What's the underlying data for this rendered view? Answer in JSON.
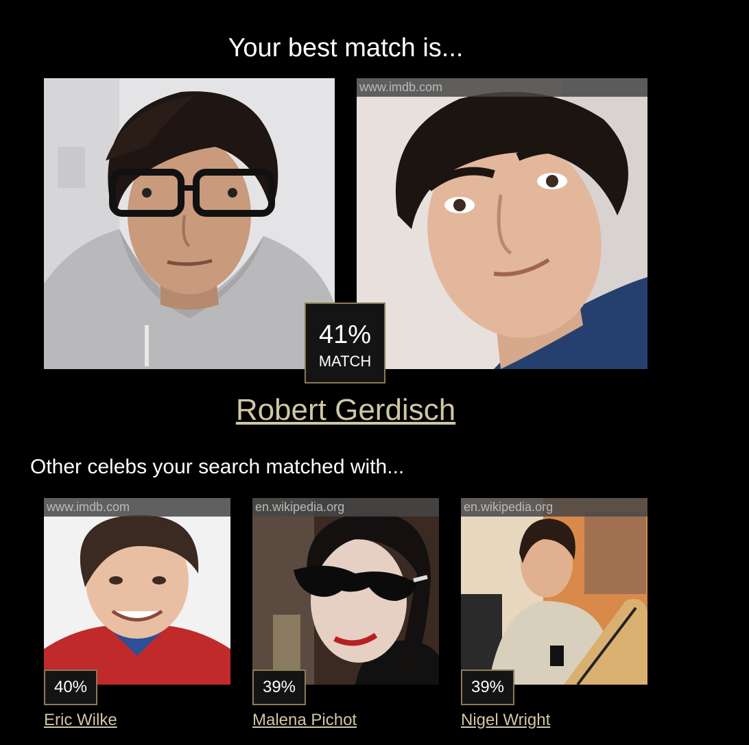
{
  "heading": "Your best match is...",
  "user_photo": {
    "alt": "your photo"
  },
  "best_match": {
    "source": "www.imdb.com",
    "percent": "41%",
    "match_label": "MATCH",
    "name": "Robert Gerdisch"
  },
  "others_heading": "Other celebs your search matched with...",
  "others": [
    {
      "source": "www.imdb.com",
      "percent": "40%",
      "name": "Eric Wilke"
    },
    {
      "source": "en.wikipedia.org",
      "percent": "39%",
      "name": "Malena Pichot"
    },
    {
      "source": "en.wikipedia.org",
      "percent": "39%",
      "name": "Nigel Wright"
    }
  ],
  "colors": {
    "background": "#000000",
    "accent_gold": "#cfc7a4",
    "badge_border": "#8a7c55"
  }
}
